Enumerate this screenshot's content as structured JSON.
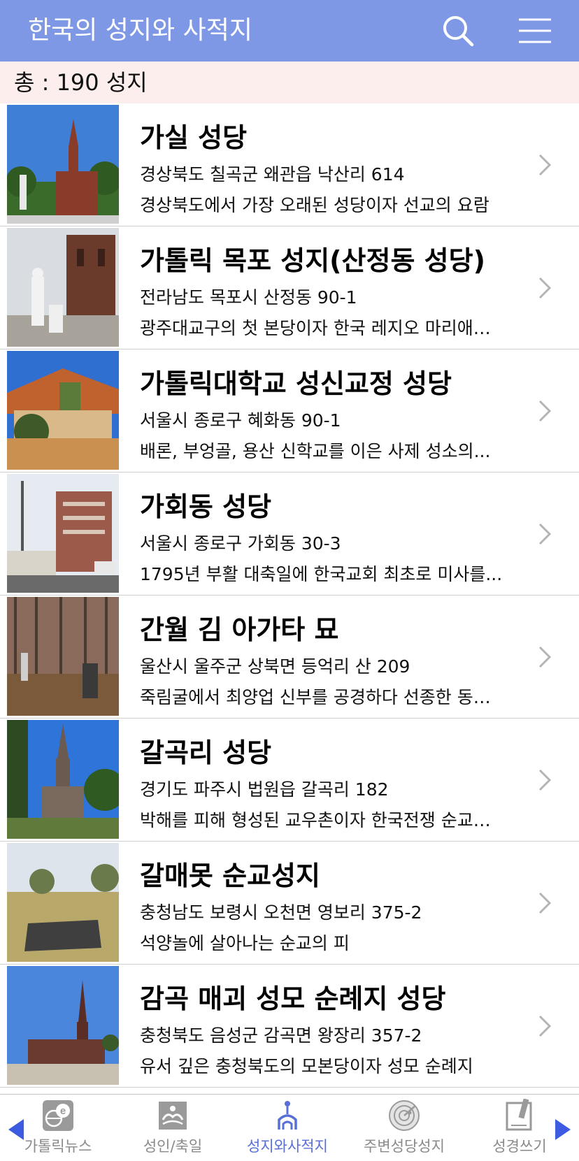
{
  "header": {
    "title": "한국의 성지와 사적지",
    "search_icon": "search-icon",
    "menu_icon": "hamburger-menu-icon"
  },
  "count": {
    "text": "총 :  190 성지"
  },
  "list": [
    {
      "title": "가실 성당",
      "address": "경상북도 칠곡군 왜관읍 낙산리 614",
      "description": "경상북도에서 가장 오래된 성당이자 선교의 요람"
    },
    {
      "title": "가톨릭 목포 성지(산정동 성당)",
      "address": "전라남도 목포시 산정동 90-1",
      "description": "광주대교구의 첫 본당이자 한국 레지오 마리애…"
    },
    {
      "title": "가톨릭대학교 성신교정 성당",
      "address": "서울시 종로구 혜화동 90-1",
      "description": "배론, 부엉골, 용산 신학교를 이은 사제 성소의..."
    },
    {
      "title": "가회동 성당",
      "address": "서울시 종로구 가회동 30-3",
      "description": "1795년 부활 대축일에 한국교회 최초로 미사를..."
    },
    {
      "title": "간월 김 아가타 묘",
      "address": "울산시 울주군 상북면 등억리 산 209",
      "description": "죽림굴에서 최양업 신부를 공경하다 선종한 동…"
    },
    {
      "title": "갈곡리 성당",
      "address": "경기도 파주시 법원읍 갈곡리 182",
      "description": "박해를 피해 형성된 교우촌이자 한국전쟁 순교…"
    },
    {
      "title": "갈매못 순교성지",
      "address": "충청남도 보령시 오천면 영보리 375-2",
      "description": "석양놀에 살아나는 순교의 피"
    },
    {
      "title": "감곡 매괴 성모 순례지 성당",
      "address": "충청북도 음성군 감곡면 왕장리 357-2",
      "description": "유서 깊은 충청북도의 모본당이자 성모 순례지"
    }
  ],
  "tabbar": {
    "tabs": [
      {
        "label": "가톨릭뉴스",
        "icon": "news-e-globe-icon"
      },
      {
        "label": "성인/축일",
        "icon": "saints-icon"
      },
      {
        "label": "성지와사적지",
        "icon": "holy-site-icon",
        "active": true
      },
      {
        "label": "주변성당성지",
        "icon": "radar-icon"
      },
      {
        "label": "성경쓰기",
        "icon": "bible-writing-icon"
      }
    ],
    "active_color": "#5a6fd6",
    "inactive_color": "#8a8a8a",
    "arrow_color": "#3d5be0"
  },
  "colors": {
    "header_bg": "#7f98e6",
    "count_bg": "#fdeeee"
  }
}
